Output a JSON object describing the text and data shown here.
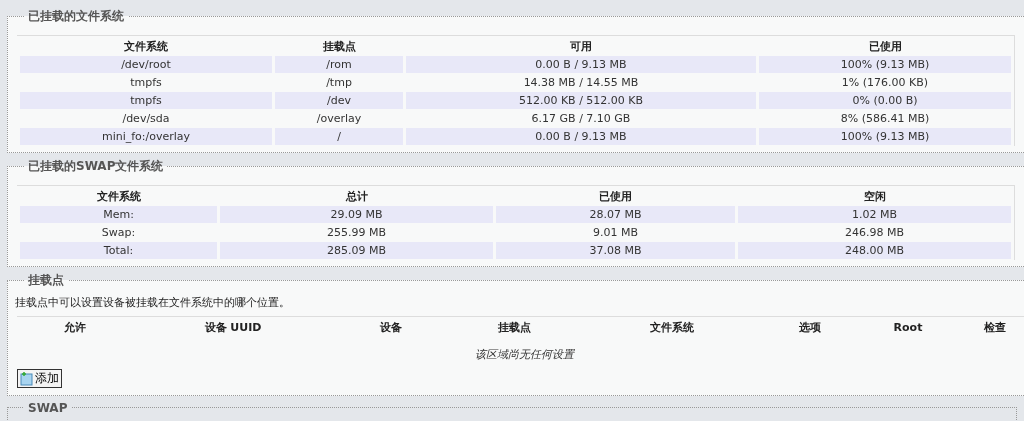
{
  "sections": [
    {
      "kind": "table",
      "legend": "已挂载的文件系统",
      "columns": [
        "文件系统",
        "挂载点",
        "可用",
        "已使用"
      ],
      "rows": [
        [
          "/dev/root",
          "/rom",
          "0.00 B / 9.13 MB",
          "100% (9.13 MB)"
        ],
        [
          "tmpfs",
          "/tmp",
          "14.38 MB / 14.55 MB",
          "1% (176.00 KB)"
        ],
        [
          "tmpfs",
          "/dev",
          "512.00 KB / 512.00 KB",
          "0% (0.00 B)"
        ],
        [
          "/dev/sda",
          "/overlay",
          "6.17 GB / 7.10 GB",
          "8% (586.41 MB)"
        ],
        [
          "mini_fo:/overlay",
          "/",
          "0.00 B / 9.13 MB",
          "100% (9.13 MB)"
        ]
      ]
    },
    {
      "kind": "table",
      "legend": "已挂载的SWAP文件系统",
      "columns": [
        "文件系统",
        "总计",
        "已使用",
        "空闲"
      ],
      "rows": [
        [
          "Mem:",
          "29.09 MB",
          "28.07 MB",
          "1.02 MB"
        ],
        [
          "Swap:",
          "255.99 MB",
          "9.01 MB",
          "246.98 MB"
        ],
        [
          "Total:",
          "285.09 MB",
          "37.08 MB",
          "248.00 MB"
        ]
      ]
    },
    {
      "kind": "mounts",
      "legend": "挂载点",
      "description": "挂载点中可以设置设备被挂载在文件系统中的哪个位置。",
      "columns": [
        "允许",
        "设备 UUID",
        "设备",
        "挂载点",
        "文件系统",
        "选项",
        "Root",
        "检查"
      ],
      "empty": "该区域尚无任何设置",
      "add_label": "添加"
    },
    {
      "kind": "stub",
      "legend": "SWAP"
    }
  ]
}
